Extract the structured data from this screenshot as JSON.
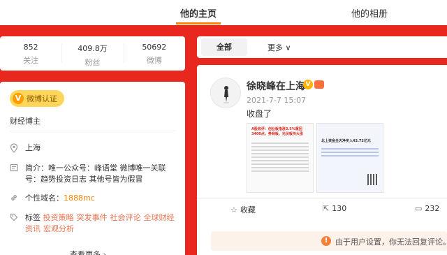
{
  "nav": {
    "home_tab": "他的主页",
    "album_tab": "他的相册"
  },
  "stats": [
    {
      "value": "852",
      "label": "关注"
    },
    {
      "value": "409.8万",
      "label": "粉丝"
    },
    {
      "value": "50692",
      "label": "微博"
    }
  ],
  "profile": {
    "badge_label": "微博认证",
    "category": "财经博主",
    "location": "上海",
    "bio_key": "简介：",
    "bio": "唯一公众号：峰语堂 微博唯一关联号：趋势投资日志 其他号皆为假冒",
    "domain_key": "个性域名：",
    "domain_value": "1888mc",
    "tags_key": "标签",
    "tags": [
      "投资策略",
      "突发事件",
      "社会评论",
      "全球财经资讯",
      "宏观分析"
    ],
    "more_label": "查看更多 ›"
  },
  "feed": {
    "all_tab": "全部",
    "more_tab": "更多 ∨"
  },
  "post": {
    "author": "徐晓峰在上海",
    "time": "2021-7-7 15:07",
    "content": "收盘了",
    "image1_headline": "A股收评：创业板指涨3.5%重回3400点，券商板、光伏板块大涨",
    "image2_headline": "北上资金全天净买入43.72亿元",
    "favorite_label": "收藏",
    "share_count": "130",
    "comment_count": "232",
    "notice": "由于用户设置，你无法回复评论。"
  },
  "colors": {
    "brand": "#ff8200",
    "background": "#e8271f"
  }
}
